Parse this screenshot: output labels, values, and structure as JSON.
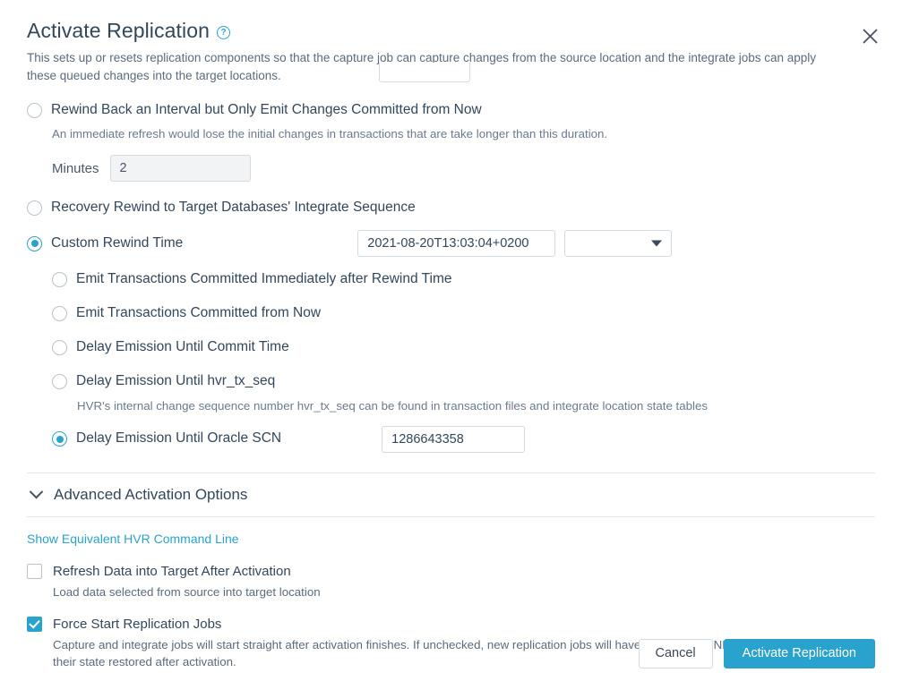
{
  "header": {
    "title": "Activate Replication",
    "help_icon": "help-circle-icon",
    "close_icon": "close-icon",
    "description": "This sets up or resets replication components so that the capture job can capture changes from the source location and the integrate jobs can apply these queued changes into the target locations."
  },
  "rewind_options": [
    {
      "id": "rewind-interval",
      "label": "Rewind Back an Interval but Only Emit Changes Committed from Now",
      "hint": "An immediate refresh would lose the initial changes in transactions that are take longer than this duration.",
      "selected": false
    },
    {
      "id": "recovery-rewind",
      "label": "Recovery Rewind to Target Databases' Integrate Sequence",
      "selected": false
    },
    {
      "id": "custom-rewind-time",
      "label": "Custom Rewind Time",
      "selected": true
    }
  ],
  "minutes_field": {
    "label": "Minutes",
    "value": "2"
  },
  "custom_rewind": {
    "timestamp_value": "2021-08-20T13:03:04+0200",
    "dropdown_value": "",
    "dropdown_icon": "chevron-down-icon"
  },
  "emission_options": [
    {
      "id": "emit-immediately-after-rewind",
      "label": "Emit Transactions Committed Immediately after Rewind Time",
      "selected": false
    },
    {
      "id": "emit-committed-from-now",
      "label": "Emit Transactions Committed from Now",
      "selected": false
    },
    {
      "id": "delay-until-commit-time",
      "label": "Delay Emission Until Commit Time",
      "selected": false
    },
    {
      "id": "delay-until-hvr-tx-seq",
      "label": "Delay Emission Until hvr_tx_seq",
      "hint": "HVR's internal change sequence number hvr_tx_seq can be found in transaction files and integrate location state tables",
      "selected": false
    },
    {
      "id": "delay-until-oracle-scn",
      "label": "Delay Emission Until Oracle SCN",
      "value": "1286643358",
      "selected": true
    }
  ],
  "advanced": {
    "label": "Advanced Activation Options",
    "chevron_icon": "chevron-down-icon",
    "expanded": true
  },
  "command_line_link": "Show Equivalent HVR Command Line",
  "checkboxes": [
    {
      "id": "refresh-data-into-target",
      "label": "Refresh Data into Target After Activation",
      "hint": "Load data selected from source into target location",
      "checked": false
    },
    {
      "id": "force-start-replication-jobs",
      "label": "Force Start Replication Jobs",
      "hint": "Capture and integrate jobs will start straight after activation finishes. If unchecked, new replication jobs will have state SUSPEND and existing jobs have their state restored after activation.",
      "checked": true
    }
  ],
  "footer": {
    "cancel_label": "Cancel",
    "submit_label": "Activate Replication"
  },
  "colors": {
    "accent": "#29a3ce",
    "text": "#33475b",
    "muted": "#5b6b7c",
    "border": "#d4dadf"
  }
}
